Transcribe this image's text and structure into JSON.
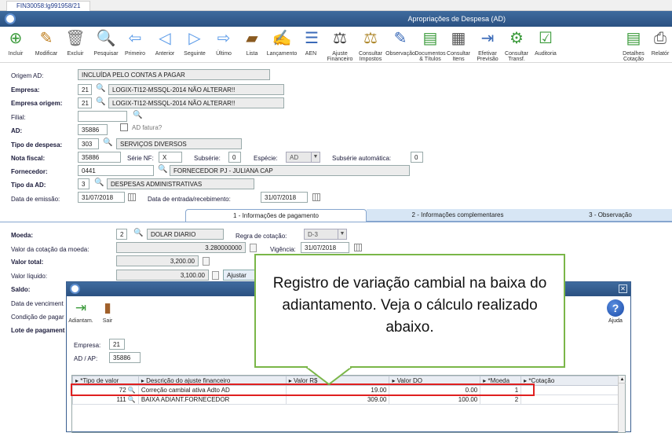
{
  "window_tab": "FIN30058:lg991958/21",
  "title": "Apropriações de Despesa (AD)",
  "toolbar": {
    "buttons": [
      {
        "label": "Incluir",
        "icon": "include-icon"
      },
      {
        "label": "Modificar",
        "icon": "edit-icon"
      },
      {
        "label": "Excluir",
        "icon": "trash-icon"
      },
      {
        "label": "Pesquisar",
        "icon": "search-icon"
      },
      {
        "label": "Primeiro",
        "icon": "first-icon"
      },
      {
        "label": "Anterior",
        "icon": "previous-icon"
      },
      {
        "label": "Seguinte",
        "icon": "next-icon"
      },
      {
        "label": "Último",
        "icon": "last-icon"
      },
      {
        "label": "Lista",
        "icon": "list-icon"
      },
      {
        "label": "Lançamento",
        "icon": "entry-icon"
      },
      {
        "label": "AEN",
        "icon": "aen-icon"
      },
      {
        "label": "Ajuste Financeiro",
        "icon": "financial-adjust-icon"
      },
      {
        "label": "Consultar Impostos",
        "icon": "taxes-icon"
      },
      {
        "label": "Observação",
        "icon": "note-icon"
      },
      {
        "label": "Documentos & Títulos",
        "icon": "documents-icon"
      },
      {
        "label": "Consultar Itens",
        "icon": "items-icon"
      },
      {
        "label": "Efetivar Previsão",
        "icon": "forecast-icon"
      },
      {
        "label": "Consultar Transf.",
        "icon": "transfer-icon"
      },
      {
        "label": "Auditoria",
        "icon": "audit-icon"
      },
      {
        "label": "Detalhes Cotação",
        "icon": "quote-details-icon"
      },
      {
        "label": "Relatór",
        "icon": "report-icon"
      }
    ]
  },
  "form": {
    "origem_label": "Origem AD:",
    "origem_value": "INCLUÍDA PELO CONTAS A PAGAR",
    "empresa_label": "Empresa:",
    "empresa_code": "21",
    "empresa_name": "LOGIX-TI12-MSSQL-2014 NÃO ALTERAR!!",
    "empresa_origem_label": "Empresa origem:",
    "empresa_origem_code": "21",
    "empresa_origem_name": "LOGIX-TI12-MSSQL-2014 NÃO ALTERAR!!",
    "filial_label": "Filial:",
    "filial_value": "",
    "ad_label": "AD:",
    "ad_value": "35886",
    "ad_fatura_label": "AD fatura?",
    "tipo_despesa_label": "Tipo de despesa:",
    "tipo_despesa_code": "303",
    "tipo_despesa_name": "SERVIÇOS DIVERSOS",
    "nota_fiscal_label": "Nota fiscal:",
    "nota_fiscal_value": "35886",
    "serie_nf_label": "Série NF:",
    "serie_nf_value": "X",
    "subserie_label": "Subsérie:",
    "subserie_value": "0",
    "especie_label": "Espécie:",
    "especie_value": "AD",
    "subserie_auto_label": "Subsérie automática:",
    "subserie_auto_value": "0",
    "fornecedor_label": "Fornecedor:",
    "fornecedor_code": "0441",
    "fornecedor_name": "FORNECEDOR PJ - JULIANA CAP",
    "tipo_ad_label": "Tipo da AD:",
    "tipo_ad_code": "3",
    "tipo_ad_name": "DESPESAS ADMINISTRATIVAS",
    "data_emissao_label": "Data de emissão:",
    "data_emissao_value": "31/07/2018",
    "data_entrada_label": "Data de entrada/recebimento:",
    "data_entrada_value": "31/07/2018"
  },
  "tabs": [
    {
      "label": "1 - Informações de pagamento"
    },
    {
      "label": "2 - Informações complementares"
    },
    {
      "label": "3 - Observação"
    }
  ],
  "payment": {
    "moeda_label": "Moeda:",
    "moeda_code": "2",
    "moeda_name": "DOLAR DIARIO",
    "regra_label": "Regra de cotação:",
    "regra_value": "D-3",
    "valor_cotacao_label": "Valor da cotação da moeda:",
    "valor_cotacao_value": "3.280000000",
    "vigencia_label": "Vigência:",
    "vigencia_value": "31/07/2018",
    "valor_total_label": "Valor total:",
    "valor_total_value": "3,200.00",
    "valor_liquido_label": "Valor líquido:",
    "valor_liquido_value": "3,100.00",
    "ajustar_label": "Ajustar",
    "saldo_label": "Saldo:",
    "data_venc_label": "Data de venciment",
    "condicao_label": "Condição de pagar",
    "lote_label": "Lote de pagament"
  },
  "modal": {
    "buttons": [
      {
        "label": "Adiantam.",
        "icon": "advance-icon"
      },
      {
        "label": "Sair",
        "icon": "exit-door-icon"
      }
    ],
    "help_label": "Ajuda",
    "empresa_label": "Empresa:",
    "empresa_value": "21",
    "ad_ap_label": "AD / AP:",
    "ad_ap_value": "35886",
    "columns": [
      "*Tipo de valor",
      "Descrição do ajuste financeiro",
      "Valor R$",
      "Valor DO",
      "*Moeda",
      "*Cotação"
    ],
    "rows": [
      {
        "tipo": "72",
        "descricao": "Correção cambial ativa Adto AD",
        "valor_rs": "19.00",
        "valor_do": "0.00",
        "moeda": "1",
        "cotacao": ""
      },
      {
        "tipo": "111",
        "descricao": "BAIXA ADIANT.FORNECEDOR",
        "valor_rs": "309.00",
        "valor_do": "100.00",
        "moeda": "2",
        "cotacao": ""
      }
    ]
  },
  "callout": {
    "text": "Registro de variação cambial na baixa do adiantamento. Veja o cálculo realizado abaixo."
  },
  "colors": {
    "titlebar": "#2b5182",
    "highlight_red": "#e02020",
    "callout_border": "#7ab648"
  }
}
